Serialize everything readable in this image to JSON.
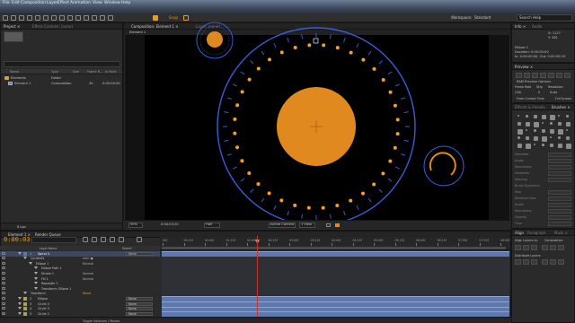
{
  "menu": [
    "File",
    "Edit",
    "Composition",
    "Layer",
    "Effect",
    "Animation",
    "View",
    "Window",
    "Help"
  ],
  "toolbar": {
    "snapping": "Snap",
    "workspace_label": "Workspace:",
    "workspace_value": "Standard",
    "search_placeholder": "Search Help"
  },
  "project": {
    "tab": "Project ×",
    "effect_tab": "Effect Controls: (none)",
    "search_placeholder": "",
    "columns": [
      "Name",
      "Type",
      "Size",
      "Frame R...",
      "In Point"
    ],
    "items": [
      {
        "name": "Elements",
        "type": "Folder",
        "size": "",
        "rate": "",
        "in": ""
      },
      {
        "name": "Element 1",
        "type": "Composition",
        "size": "",
        "rate": "30",
        "in": "0:00:00:00"
      }
    ],
    "footer": "8 bpc"
  },
  "viewer": {
    "tab": "Composition: Element 1 ×",
    "layer_tab": "Layer: (none)",
    "breadcrumb": "Element 1",
    "zoom": "50%",
    "timecode": "0:00:03:20",
    "resolution": "Half",
    "camera": "Active Camera",
    "view": "1 View"
  },
  "timeline": {
    "tab": "Element 1 ×",
    "render_tab": "Render Queue",
    "timecode": "0:00:03:20",
    "search_placeholder": "",
    "column_head": "Layer Name",
    "parent_head": "Parent",
    "ruler": [
      "00f",
      "00:15f",
      "01:00f",
      "01:15f",
      "02:00f",
      "02:15f",
      "03:00f",
      "03:15f",
      "04:00f",
      "04:15f",
      "05:00f",
      "05:15f",
      "06:00f",
      "06:15f",
      "07:00f",
      "07:15f",
      "08:00f"
    ],
    "layers": [
      {
        "num": "1",
        "name": "Spiral 3",
        "color": "#5f78ad",
        "parent": "None",
        "selected": true
      },
      {
        "name": "Contents",
        "indent": 1,
        "extra": "Add: ●"
      },
      {
        "name": "Ellipse 1",
        "indent": 2,
        "extra": "Normal"
      },
      {
        "name": "Ellipse Path 1",
        "indent": 3,
        "extra": ""
      },
      {
        "name": "Stroke 1",
        "indent": 3,
        "extra": "Normal"
      },
      {
        "name": "Fill 1",
        "indent": 3,
        "extra": "Normal"
      },
      {
        "name": "Repeater 1",
        "indent": 3,
        "extra": ""
      },
      {
        "name": "Transform: Ellipse 1",
        "indent": 3,
        "extra": ""
      },
      {
        "name": "Transform",
        "indent": 1,
        "extra": "Reset"
      },
      {
        "num": "2",
        "name": "Ellipse",
        "color": "#a6a25a",
        "parent": "None"
      },
      {
        "num": "3",
        "name": "Circle 4",
        "color": "#a6a25a",
        "parent": "None"
      },
      {
        "num": "4",
        "name": "Circle 3",
        "color": "#a6a25a",
        "parent": "None"
      },
      {
        "num": "5",
        "name": "Circle 2",
        "color": "#a6a25a",
        "parent": "None"
      }
    ],
    "footer": "Toggle Switches / Modes"
  },
  "info": {
    "tab": "Info ×",
    "audio_tab": "Audio",
    "x": "X: 1127",
    "y": "Y: 381",
    "layer": "Ellipse 1",
    "duration": "Duration: 0:00:00:00",
    "in_out": "In: 0:00:00:00, Out: 0:00:05:29"
  },
  "preview": {
    "tab": "Preview ×",
    "ram_options": "RAM Preview Options",
    "frame_rate_label": "Frame Rate",
    "skip_label": "Skip",
    "resolution_label": "Resolution",
    "frame_rate": "(30)",
    "skip": "0",
    "resolution": "Auto",
    "from_current": "From Current Time",
    "full_screen": "Full Screen"
  },
  "effects": {
    "tab": "Effects & Presets",
    "brushes_tab": "Brushes ×",
    "fields": [
      "Diameter",
      "Angle",
      "Roundness",
      "Hardness",
      "Spacing"
    ],
    "dynamics": "Brush Dynamics",
    "dyn_fields": [
      "Size",
      "Minimum Size",
      "Angle",
      "Roundness",
      "Opacity",
      "Flow"
    ]
  },
  "paragraph": {
    "tab": "Align",
    "tab2": "Paragraph",
    "tab3": "Mask ×",
    "align_label": "Align Layers to:",
    "align_value": "Composition",
    "distribute": "Distribute Layers:"
  },
  "colors": {
    "accent_orange": "#e89a2a",
    "ring_blue": "#3d5bd8",
    "dot_orange": "#f0a030",
    "layer_blue": "#5f78ad"
  }
}
